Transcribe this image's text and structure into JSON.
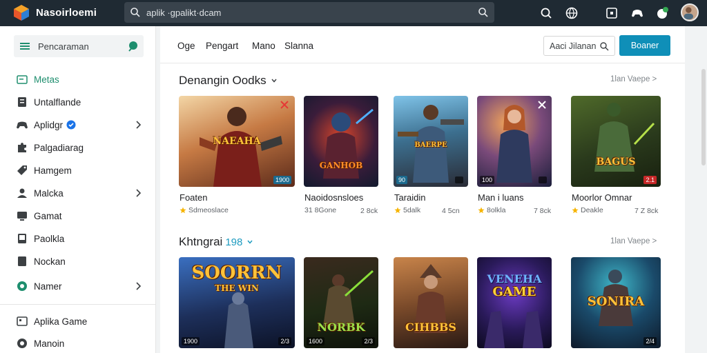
{
  "header": {
    "brand": "Nasoirloemi",
    "search_value": "aplik ·gpalikt·dcam"
  },
  "sidebar": {
    "head_label": "Pencaraman",
    "items": [
      {
        "label": "Metas",
        "icon": "image-icon",
        "active": true
      },
      {
        "label": "Untalflande",
        "icon": "document-icon"
      },
      {
        "label": "Aplidgr",
        "icon": "game-controller-icon",
        "verified": true,
        "chevron": true
      },
      {
        "label": "Palgadiarag",
        "icon": "puzzle-icon"
      },
      {
        "label": "Hamgem",
        "icon": "tag-icon"
      },
      {
        "label": "Malcka",
        "icon": "user-icon",
        "chevron": true
      },
      {
        "label": "Gamat",
        "icon": "monitor-icon"
      },
      {
        "label": "Paolkla",
        "icon": "book-icon"
      },
      {
        "label": "Nockan",
        "icon": "bookmark-icon"
      },
      {
        "label": "Namer",
        "icon": "circle-icon",
        "chevron": true
      },
      {
        "label": "Aplika Game",
        "icon": "grid-icon"
      },
      {
        "label": "Manoin",
        "icon": "globe-icon"
      }
    ]
  },
  "main": {
    "tabs": [
      "Oge",
      "Pengart",
      "Mano",
      "Slanna"
    ],
    "filter_label": "Aaci Jilanan",
    "primary_button": "Boaner",
    "section1": {
      "title": "Denangin Oodks",
      "view_more": "1lan Vaepe >",
      "cards": [
        {
          "title": "Foaten",
          "meta": "Sdmeoslace",
          "meta2": "",
          "badge": "1900",
          "art": "NAEAHA"
        },
        {
          "title": "Naoidosnsloes",
          "meta": "31 8Gone",
          "meta2": "2 8ck",
          "badge": "",
          "art": "GANHOB"
        },
        {
          "title": "Taraidin",
          "meta": "5dalk",
          "meta2": "4 5cn",
          "badge": "90",
          "art": "BAERPE"
        },
        {
          "title": "Man i luans",
          "meta": "8olkla",
          "meta2": "7 8ck",
          "badge": "100",
          "art": ""
        },
        {
          "title": "Moorlor Omnar",
          "meta": "Deakle",
          "meta2": "7 Z 8ck",
          "badge": "2.1",
          "art": "BAGUS"
        }
      ]
    },
    "section2": {
      "title": "Khtngrai",
      "count": "198",
      "view_more": "1lan Vaepe >",
      "cards": [
        {
          "badge": "1900",
          "badge2": "2/3",
          "art": "SOORRN",
          "art2": "THE WIN"
        },
        {
          "badge": "1600",
          "badge2": "2/3",
          "art": "NORBK",
          "art2": ""
        },
        {
          "badge": "",
          "badge2": "",
          "art": "CIHBBS",
          "art2": ""
        },
        {
          "badge": "",
          "badge2": "",
          "art": "VENEHA",
          "art2": "GAME"
        },
        {
          "badge": "",
          "badge2": "2/4",
          "art": "SONIRA",
          "art2": ""
        }
      ]
    }
  }
}
